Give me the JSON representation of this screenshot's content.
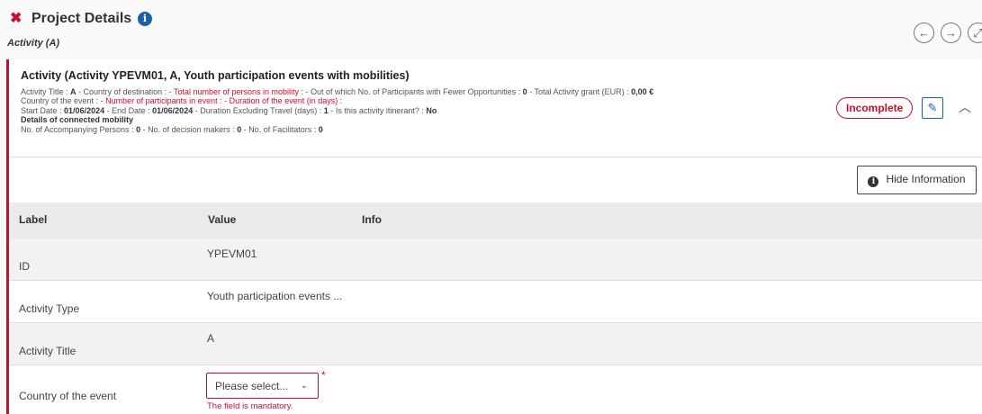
{
  "header": {
    "close_glyph": "✖",
    "title": "Project Details",
    "info_glyph": "i",
    "subtitle": "Activity (A)",
    "nav_prev": "←",
    "nav_next": "→",
    "nav_expand": "⤢"
  },
  "activity": {
    "title": "Activity (Activity YPEVM01, A, Youth participation events with mobilities)",
    "status": "Incomplete",
    "edit_glyph": "✎",
    "collapse_glyph": "︿",
    "summary": {
      "l1_activity_title_label": "Activity Title :",
      "l1_activity_title_value": "A",
      "l1_country_label": "- Country of destination :",
      "l1_total_persons_label": "- Total number of persons in mobility :",
      "l1_fewer_opp_label": "- Out of which No. of Participants with Fewer Opportunities :",
      "l1_fewer_opp_value": "0",
      "l1_grant_label": "- Total Activity grant (EUR) :",
      "l1_grant_value": "0,00 €",
      "l2_country_event_label": "Country of the event :",
      "l2_participants_label": "- Number of participants in event :",
      "l2_duration_label": "- Duration of the event (in days) :",
      "l3_start_label": "Start Date :",
      "l3_start_value": "01/06/2024",
      "l3_end_label": "- End Date :",
      "l3_end_value": "01/06/2024",
      "l3_excl_label": "- Duration Excluding Travel (days) :",
      "l3_excl_value": "1",
      "l3_itinerant_label": "- Is this activity itinerant? :",
      "l3_itinerant_value": "No",
      "l4_heading": "Details of connected mobility",
      "l5_accomp_label": "No. of Accompanying Persons :",
      "l5_accomp_value": "0",
      "l5_decision_label": "- No. of decision makers :",
      "l5_decision_value": "0",
      "l5_facilitators_label": "- No. of Facilitators :",
      "l5_facilitators_value": "0"
    }
  },
  "hide_info": {
    "label": "Hide Information",
    "icon": "i"
  },
  "table": {
    "headers": {
      "label": "Label",
      "value": "Value",
      "info": "Info"
    },
    "rows": [
      {
        "label": "ID",
        "value": "YPEVM01"
      },
      {
        "label": "Activity Type",
        "value": "Youth participation events ..."
      },
      {
        "label": "Activity Title",
        "value": "A"
      },
      {
        "label": "Country of the event",
        "placeholder": "Please select...",
        "caret": "⌄",
        "required": "*",
        "error": "The field is mandatory."
      }
    ]
  },
  "colors": {
    "accent_red": "#c8102e",
    "brand_blue": "#1a5fa8"
  }
}
